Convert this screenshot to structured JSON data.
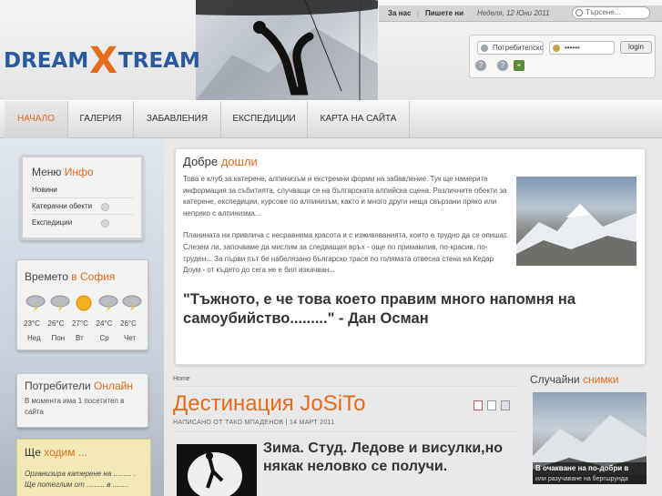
{
  "header": {
    "logo_left": "DREAM",
    "logo_x": "X",
    "logo_right": "TREAM",
    "top_links": [
      "За нас",
      "Пишете ни"
    ],
    "top_separator": "|",
    "date": "Неделя, 12 Юни 2011",
    "search_placeholder": "Търсене...",
    "login": {
      "username": "Потребителско",
      "password": "••••••",
      "button": "login"
    }
  },
  "nav": {
    "items": [
      "НАЧАЛО",
      "ГАЛЕРИЯ",
      "ЗАБАВЛЕНИЯ",
      "ЕКСПЕДИЦИИ",
      "КАРТА НА САЙТА"
    ]
  },
  "menu_panel": {
    "title_a": "Меню",
    "title_b": "Инфо",
    "items": [
      "Новини",
      "Катерачни обекти",
      "Експедиции"
    ]
  },
  "weather_panel": {
    "title_a": "Времето",
    "title_b": "в София",
    "days": [
      {
        "temp": "23°C",
        "day": "Нед",
        "icon": "storm-icon"
      },
      {
        "temp": "26°C",
        "day": "Пон",
        "icon": "storm-icon"
      },
      {
        "temp": "27°C",
        "day": "Вт",
        "icon": "sun-icon"
      },
      {
        "temp": "24°C",
        "day": "Ср",
        "icon": "storm-icon"
      },
      {
        "temp": "26°C",
        "day": "Чет",
        "icon": "storm-icon"
      }
    ]
  },
  "users_panel": {
    "title_a": "Потребители",
    "title_b": "Онлайн",
    "text": "В момента има 1 посетител в сайта"
  },
  "club_panel": {
    "title_a": "Ще",
    "title_b": "ходим ...",
    "text": "Организира катерене на ......... . Ще потеглим от ......... в ........"
  },
  "welcome": {
    "title_a": "Добре",
    "title_b": "дошли",
    "p1": "Това е клуб за катерене, алпинизъм и екстремни форми на забавление. Тук ще намерите информация за събитията, случващи се на българската алпийска сцена. Различните обекти за катерене, експедиции, курсове по алпинизъм, както и много други неща свързани пряко или непряко с алпинизма...",
    "p2": "Планината ни привлича с несравнима красота и с изживяванията, които е трудно да се опишат. Слезем ли, започваме да мислим за следващия връх - още по примамлив, по-красив, по-труден...    За първи път бе набелязано българско трасе по голямата отвесна стена на Кедар Доум - от където до сега не е бил изкачван...",
    "quote": "\"Тъжното, е че това което правим много напомня на самоубийство.........\" - Дан Осман"
  },
  "article": {
    "breadcrumb": "Home",
    "title": "Дестинация JoSiTo",
    "meta": "НАПИСАНО ОТ ТАКО МПАДЕНОВ | 14 МАРТ 2011",
    "headline": "Зима. Студ. Ледове и висулки,но някак неловко се получи."
  },
  "random_photos": {
    "title_a": "Случайни",
    "title_b": "снимки",
    "caption": "В очакване на по-добри в",
    "subcaption": "или разучаване на бергшрунда"
  },
  "colors": {
    "accent": "#e56c1b",
    "logo_blue": "#2a5a9e"
  }
}
